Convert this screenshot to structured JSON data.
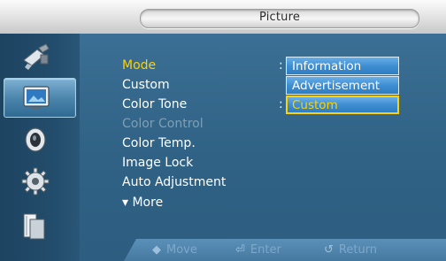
{
  "title": "Picture",
  "menu": {
    "items": [
      {
        "label": "Mode",
        "state": "selected"
      },
      {
        "label": "Custom",
        "state": "normal"
      },
      {
        "label": "Color Tone",
        "state": "normal"
      },
      {
        "label": "Color Control",
        "state": "disabled"
      },
      {
        "label": "Color Temp.",
        "state": "normal"
      },
      {
        "label": "Image Lock",
        "state": "normal"
      },
      {
        "label": "Auto Adjustment",
        "state": "normal"
      },
      {
        "label": "▾ More",
        "state": "normal"
      }
    ],
    "colon": ":"
  },
  "dropdown": {
    "options": [
      "Information",
      "Advertisement",
      "Custom"
    ],
    "selected": "Custom"
  },
  "sidebar": {
    "icons": [
      "input-icon",
      "picture-icon",
      "sound-icon",
      "setup-icon",
      "multi-control-icon"
    ],
    "active": "picture-icon"
  },
  "footer": {
    "move_icon": "◆",
    "move": "Move",
    "enter_icon": "⏎",
    "enter": "Enter",
    "return_icon": "↺",
    "return": "Return"
  },
  "colors": {
    "selected_text": "#ffd200",
    "disabled_text": "#7f9fb6",
    "dropdown_bg": "#3f8ed2",
    "panel_bg": "#2f6285"
  }
}
